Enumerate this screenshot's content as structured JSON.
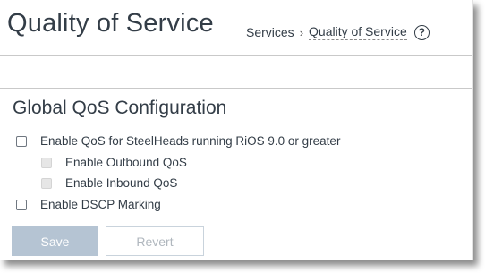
{
  "header": {
    "title": "Quality of Service",
    "breadcrumb": {
      "parent": "Services",
      "separator": "›",
      "current": "Quality of Service"
    },
    "help_icon": "?"
  },
  "section": {
    "title": "Global QoS Configuration",
    "options": [
      {
        "label": "Enable QoS for SteelHeads running RiOS 9.0 or greater",
        "checked": false,
        "disabled": false
      },
      {
        "label": "Enable Outbound QoS",
        "checked": false,
        "disabled": true
      },
      {
        "label": "Enable Inbound QoS",
        "checked": false,
        "disabled": true
      },
      {
        "label": "Enable DSCP Marking",
        "checked": false,
        "disabled": false
      }
    ]
  },
  "buttons": {
    "save_label": "Save",
    "revert_label": "Revert"
  },
  "colors": {
    "text": "#333d47",
    "save_bg": "#b5c4d3",
    "revert_text": "#b0b7be",
    "divider": "#c9c9c9"
  }
}
